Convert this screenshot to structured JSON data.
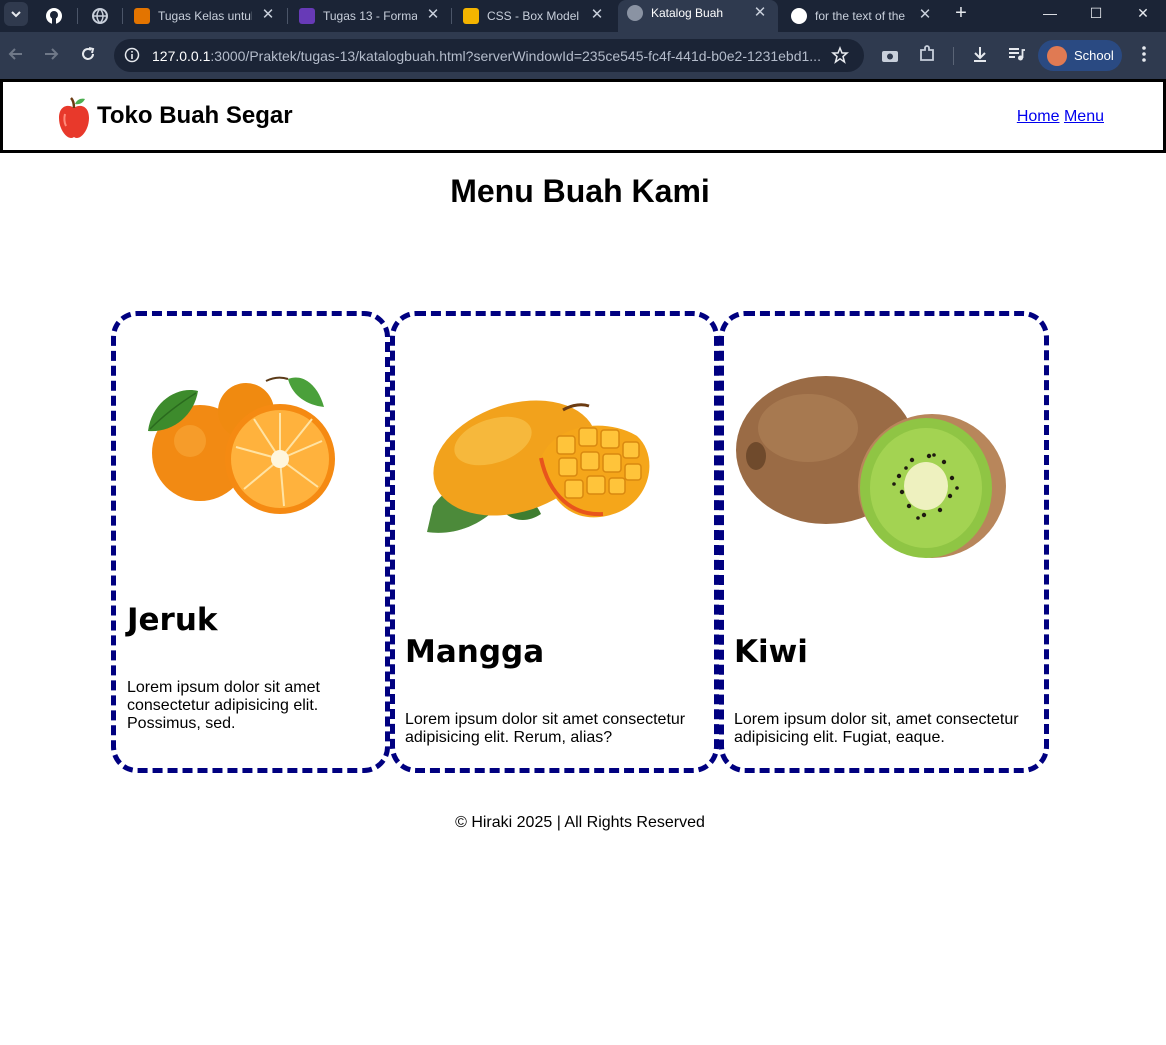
{
  "browser": {
    "tabs": [
      {
        "title": "",
        "icon": "github-icon"
      },
      {
        "title": "",
        "icon": "globe-icon"
      },
      {
        "title": "Tugas Kelas untuk",
        "icon": "classroom-icon"
      },
      {
        "title": "Tugas 13 - Forma",
        "icon": "forms-icon"
      },
      {
        "title": "CSS - Box Model",
        "icon": "slides-icon"
      },
      {
        "title": "Katalog Buah",
        "icon": "globe-icon"
      },
      {
        "title": "for the text of the",
        "icon": "google-icon"
      }
    ],
    "address": {
      "host": "127.0.0.1",
      "rest": ":3000/Praktek/tugas-13/katalogbuah.html?serverWindowId=235ce545-fc4f-441d-b0e2-1231ebd1..."
    },
    "profile": "School"
  },
  "site": {
    "brand": "Toko Buah Segar",
    "nav": [
      "Home",
      "Menu"
    ],
    "title": "Menu Buah Kami",
    "cards": [
      {
        "name": "Jeruk",
        "desc": "Lorem ipsum dolor sit amet consectetur adipisicing elit. Possimus, sed."
      },
      {
        "name": "Mangga",
        "desc": "Lorem ipsum dolor sit amet consectetur adipisicing elit. Rerum, alias?"
      },
      {
        "name": "Kiwi",
        "desc": "Lorem ipsum dolor sit, amet consectetur adipisicing elit. Fugiat, eaque."
      }
    ],
    "footer": "© Hiraki 2025 | All Rights Reserved"
  },
  "colors": {
    "card_border": "#000080",
    "link": "#0000ee",
    "chrome_dark": "#1b2436",
    "chrome_toolbar": "#2f3a4f"
  }
}
